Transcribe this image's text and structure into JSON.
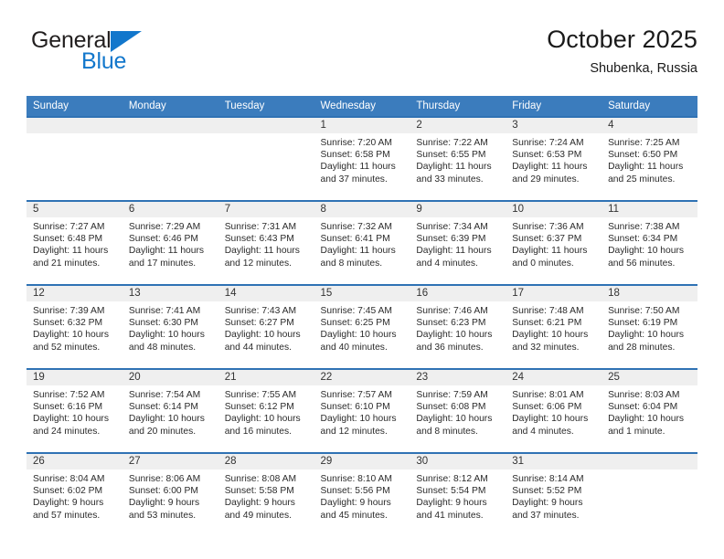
{
  "brand": {
    "name_top": "General",
    "name_bottom": "Blue",
    "flag_color": "#1277cc"
  },
  "header": {
    "title": "October 2025",
    "location": "Shubenka, Russia"
  },
  "theme": {
    "header_blue": "#3b7cbd",
    "row_rule_blue": "#2f72b4",
    "daynum_band": "#efefef"
  },
  "calendar": {
    "weekday_headers": [
      "Sunday",
      "Monday",
      "Tuesday",
      "Wednesday",
      "Thursday",
      "Friday",
      "Saturday"
    ],
    "weeks": [
      [
        {
          "day": "",
          "lines": []
        },
        {
          "day": "",
          "lines": []
        },
        {
          "day": "",
          "lines": []
        },
        {
          "day": "1",
          "lines": [
            "Sunrise: 7:20 AM",
            "Sunset: 6:58 PM",
            "Daylight: 11 hours",
            "and 37 minutes."
          ]
        },
        {
          "day": "2",
          "lines": [
            "Sunrise: 7:22 AM",
            "Sunset: 6:55 PM",
            "Daylight: 11 hours",
            "and 33 minutes."
          ]
        },
        {
          "day": "3",
          "lines": [
            "Sunrise: 7:24 AM",
            "Sunset: 6:53 PM",
            "Daylight: 11 hours",
            "and 29 minutes."
          ]
        },
        {
          "day": "4",
          "lines": [
            "Sunrise: 7:25 AM",
            "Sunset: 6:50 PM",
            "Daylight: 11 hours",
            "and 25 minutes."
          ]
        }
      ],
      [
        {
          "day": "5",
          "lines": [
            "Sunrise: 7:27 AM",
            "Sunset: 6:48 PM",
            "Daylight: 11 hours",
            "and 21 minutes."
          ]
        },
        {
          "day": "6",
          "lines": [
            "Sunrise: 7:29 AM",
            "Sunset: 6:46 PM",
            "Daylight: 11 hours",
            "and 17 minutes."
          ]
        },
        {
          "day": "7",
          "lines": [
            "Sunrise: 7:31 AM",
            "Sunset: 6:43 PM",
            "Daylight: 11 hours",
            "and 12 minutes."
          ]
        },
        {
          "day": "8",
          "lines": [
            "Sunrise: 7:32 AM",
            "Sunset: 6:41 PM",
            "Daylight: 11 hours",
            "and 8 minutes."
          ]
        },
        {
          "day": "9",
          "lines": [
            "Sunrise: 7:34 AM",
            "Sunset: 6:39 PM",
            "Daylight: 11 hours",
            "and 4 minutes."
          ]
        },
        {
          "day": "10",
          "lines": [
            "Sunrise: 7:36 AM",
            "Sunset: 6:37 PM",
            "Daylight: 11 hours",
            "and 0 minutes."
          ]
        },
        {
          "day": "11",
          "lines": [
            "Sunrise: 7:38 AM",
            "Sunset: 6:34 PM",
            "Daylight: 10 hours",
            "and 56 minutes."
          ]
        }
      ],
      [
        {
          "day": "12",
          "lines": [
            "Sunrise: 7:39 AM",
            "Sunset: 6:32 PM",
            "Daylight: 10 hours",
            "and 52 minutes."
          ]
        },
        {
          "day": "13",
          "lines": [
            "Sunrise: 7:41 AM",
            "Sunset: 6:30 PM",
            "Daylight: 10 hours",
            "and 48 minutes."
          ]
        },
        {
          "day": "14",
          "lines": [
            "Sunrise: 7:43 AM",
            "Sunset: 6:27 PM",
            "Daylight: 10 hours",
            "and 44 minutes."
          ]
        },
        {
          "day": "15",
          "lines": [
            "Sunrise: 7:45 AM",
            "Sunset: 6:25 PM",
            "Daylight: 10 hours",
            "and 40 minutes."
          ]
        },
        {
          "day": "16",
          "lines": [
            "Sunrise: 7:46 AM",
            "Sunset: 6:23 PM",
            "Daylight: 10 hours",
            "and 36 minutes."
          ]
        },
        {
          "day": "17",
          "lines": [
            "Sunrise: 7:48 AM",
            "Sunset: 6:21 PM",
            "Daylight: 10 hours",
            "and 32 minutes."
          ]
        },
        {
          "day": "18",
          "lines": [
            "Sunrise: 7:50 AM",
            "Sunset: 6:19 PM",
            "Daylight: 10 hours",
            "and 28 minutes."
          ]
        }
      ],
      [
        {
          "day": "19",
          "lines": [
            "Sunrise: 7:52 AM",
            "Sunset: 6:16 PM",
            "Daylight: 10 hours",
            "and 24 minutes."
          ]
        },
        {
          "day": "20",
          "lines": [
            "Sunrise: 7:54 AM",
            "Sunset: 6:14 PM",
            "Daylight: 10 hours",
            "and 20 minutes."
          ]
        },
        {
          "day": "21",
          "lines": [
            "Sunrise: 7:55 AM",
            "Sunset: 6:12 PM",
            "Daylight: 10 hours",
            "and 16 minutes."
          ]
        },
        {
          "day": "22",
          "lines": [
            "Sunrise: 7:57 AM",
            "Sunset: 6:10 PM",
            "Daylight: 10 hours",
            "and 12 minutes."
          ]
        },
        {
          "day": "23",
          "lines": [
            "Sunrise: 7:59 AM",
            "Sunset: 6:08 PM",
            "Daylight: 10 hours",
            "and 8 minutes."
          ]
        },
        {
          "day": "24",
          "lines": [
            "Sunrise: 8:01 AM",
            "Sunset: 6:06 PM",
            "Daylight: 10 hours",
            "and 4 minutes."
          ]
        },
        {
          "day": "25",
          "lines": [
            "Sunrise: 8:03 AM",
            "Sunset: 6:04 PM",
            "Daylight: 10 hours",
            "and 1 minute."
          ]
        }
      ],
      [
        {
          "day": "26",
          "lines": [
            "Sunrise: 8:04 AM",
            "Sunset: 6:02 PM",
            "Daylight: 9 hours",
            "and 57 minutes."
          ]
        },
        {
          "day": "27",
          "lines": [
            "Sunrise: 8:06 AM",
            "Sunset: 6:00 PM",
            "Daylight: 9 hours",
            "and 53 minutes."
          ]
        },
        {
          "day": "28",
          "lines": [
            "Sunrise: 8:08 AM",
            "Sunset: 5:58 PM",
            "Daylight: 9 hours",
            "and 49 minutes."
          ]
        },
        {
          "day": "29",
          "lines": [
            "Sunrise: 8:10 AM",
            "Sunset: 5:56 PM",
            "Daylight: 9 hours",
            "and 45 minutes."
          ]
        },
        {
          "day": "30",
          "lines": [
            "Sunrise: 8:12 AM",
            "Sunset: 5:54 PM",
            "Daylight: 9 hours",
            "and 41 minutes."
          ]
        },
        {
          "day": "31",
          "lines": [
            "Sunrise: 8:14 AM",
            "Sunset: 5:52 PM",
            "Daylight: 9 hours",
            "and 37 minutes."
          ]
        },
        {
          "day": "",
          "lines": []
        }
      ]
    ]
  }
}
